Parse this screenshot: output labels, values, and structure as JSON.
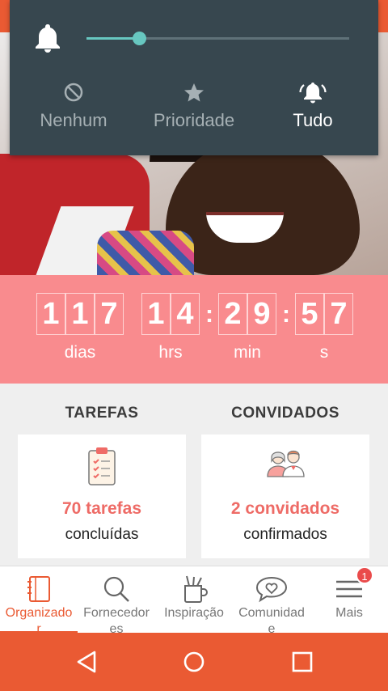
{
  "notification_panel": {
    "volume_level": 0.2,
    "modes": [
      {
        "label": "Nenhum",
        "icon": "block-icon"
      },
      {
        "label": "Prioridade",
        "icon": "star-icon"
      },
      {
        "label": "Tudo",
        "icon": "bell-ringing-icon"
      }
    ],
    "active_mode": "Tudo"
  },
  "countdown": {
    "days": [
      "1",
      "1",
      "7"
    ],
    "hours": [
      "1",
      "4"
    ],
    "minutes": [
      "2",
      "9"
    ],
    "seconds": [
      "5",
      "7"
    ],
    "labels": {
      "days": "dias",
      "hours": "hrs",
      "minutes": "min",
      "seconds": "s"
    }
  },
  "sections": {
    "tasks": {
      "title": "TAREFAS",
      "count": "70 tarefas",
      "sub": "concluídas"
    },
    "guests": {
      "title": "CONVIDADOS",
      "count": "2 convidados",
      "sub": "confirmados"
    }
  },
  "tabs": [
    {
      "label": "Organizado\nr",
      "icon": "notebook-icon"
    },
    {
      "label": "Fornecedor\nes",
      "icon": "search-icon"
    },
    {
      "label": "Inspiração",
      "icon": "cup-pencils-icon"
    },
    {
      "label": "Comunidad\ne",
      "icon": "heart-chat-icon"
    },
    {
      "label": "Mais",
      "icon": "menu-icon"
    }
  ],
  "more_badge": "1",
  "colors": {
    "accent": "#ea5a33",
    "countdown_bg": "#f98b8e",
    "panel_bg": "#37474f",
    "teal": "#67c7c0"
  }
}
